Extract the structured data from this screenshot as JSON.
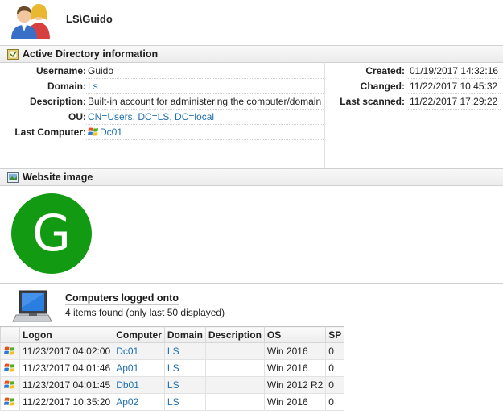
{
  "header": {
    "title": "LS\\Guido",
    "icon": "users-icon"
  },
  "ad_section": {
    "title": "Active Directory information",
    "icon": "directory-book-icon",
    "left": [
      {
        "label": "Username:",
        "value": "Guido",
        "link": false
      },
      {
        "label": "Domain:",
        "value": "Ls",
        "link": true
      },
      {
        "label": "Description:",
        "value": "Built-in account for administering the computer/domain",
        "link": false
      },
      {
        "label": "OU:",
        "value": "CN=Users, DC=LS, DC=local",
        "link": true
      },
      {
        "label": "Last Computer:",
        "value": "Dc01",
        "link": true,
        "icon": "windows-flag-icon"
      }
    ],
    "right": [
      {
        "label": "Created:",
        "value": "01/19/2017 14:32:16"
      },
      {
        "label": "Changed:",
        "value": "11/22/2017 10:45:32"
      },
      {
        "label": "Last scanned:",
        "value": "11/22/2017 17:29:22"
      }
    ]
  },
  "website_section": {
    "title": "Website image",
    "icon": "picture-icon",
    "avatar_letter": "G",
    "avatar_color": "#139a13"
  },
  "computers_section": {
    "title": "Computers logged onto",
    "subtitle": "4 items found (only last 50 displayed)",
    "icon": "computer-monitor-icon",
    "columns": [
      "Logon",
      "Computer",
      "Domain",
      "Description",
      "OS",
      "SP"
    ],
    "rows": [
      {
        "logon": "11/23/2017 04:02:00",
        "computer": "Dc01",
        "domain": "LS",
        "description": "",
        "os": "Win 2016",
        "sp": "0"
      },
      {
        "logon": "11/23/2017 04:01:46",
        "computer": "Ap01",
        "domain": "LS",
        "description": "",
        "os": "Win 2016",
        "sp": "0"
      },
      {
        "logon": "11/23/2017 04:01:45",
        "computer": "Db01",
        "domain": "LS",
        "description": "",
        "os": "Win 2012 R2",
        "sp": "0"
      },
      {
        "logon": "11/22/2017 10:35:20",
        "computer": "Ap02",
        "domain": "LS",
        "description": "",
        "os": "Win 2016",
        "sp": "0"
      }
    ]
  },
  "colors": {
    "link": "#1f6fb2",
    "section_bar": "#ececec"
  }
}
